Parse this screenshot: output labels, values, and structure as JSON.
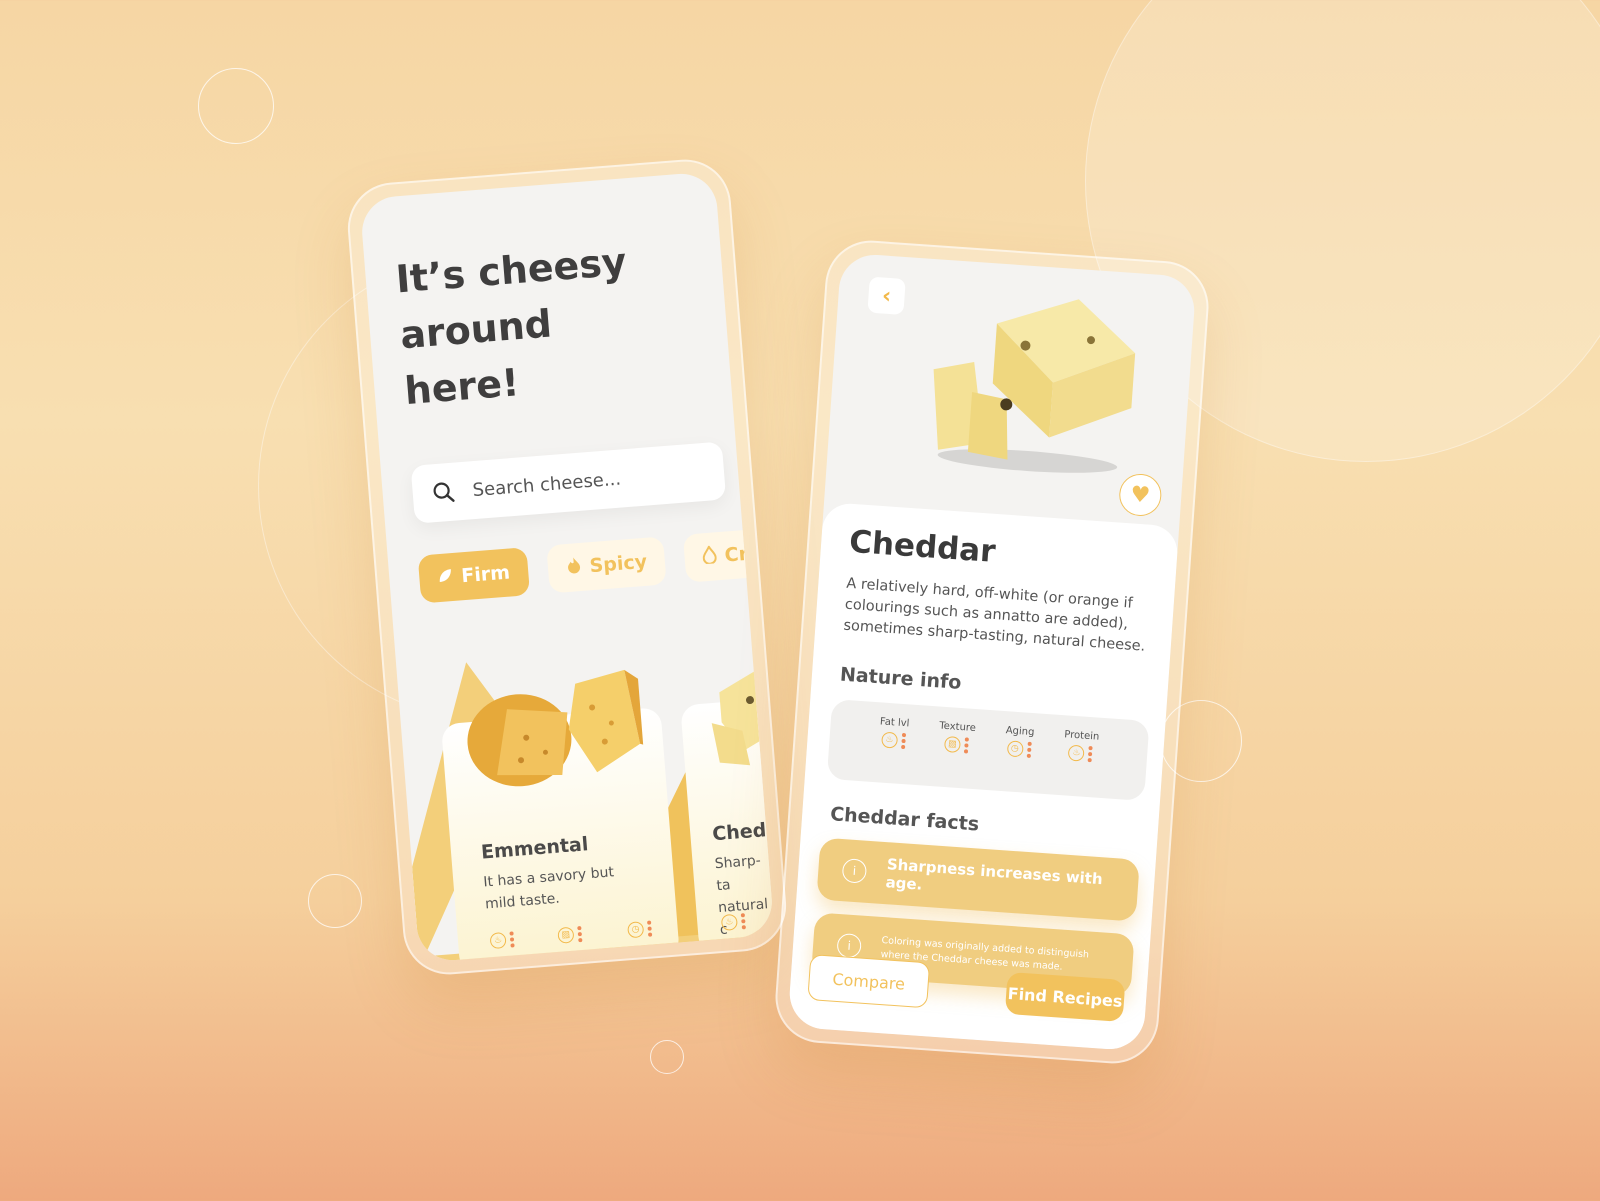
{
  "home": {
    "headline": "It’s cheesy around here!",
    "search": {
      "placeholder": "Search cheese..."
    },
    "filters": [
      {
        "label": "Firm",
        "icon": "leaf-icon",
        "active": true
      },
      {
        "label": "Spicy",
        "icon": "flame-icon",
        "active": false
      },
      {
        "label": "Crea",
        "icon": "drop-icon",
        "active": false
      }
    ],
    "cards": [
      {
        "name": "Emmental",
        "description": "It has a savory but mild taste."
      },
      {
        "name": "Chedda",
        "description": "Sharp-ta natural c"
      }
    ]
  },
  "detail": {
    "title": "Cheddar",
    "description": "A relatively hard, off-white (or orange if colourings such as annatto are added), sometimes sharp-tasting, natural cheese.",
    "nature_heading": "Nature info",
    "nature": [
      {
        "label": "Fat lvl",
        "icon": "flame-icon"
      },
      {
        "label": "Texture",
        "icon": "texture-icon"
      },
      {
        "label": "Aging",
        "icon": "clock-icon"
      },
      {
        "label": "Protein",
        "icon": "flame-icon"
      }
    ],
    "facts_heading": "Cheddar facts",
    "facts": [
      "Sharpness increases with age.",
      "Coloring was originally added to distinguish where the Cheddar cheese was made."
    ],
    "compare_label": "Compare",
    "recipes_label": "Find Recipes"
  },
  "colors": {
    "accent": "#f2c25d",
    "dots": "#ef8b57",
    "background": "#f6d6a4"
  }
}
